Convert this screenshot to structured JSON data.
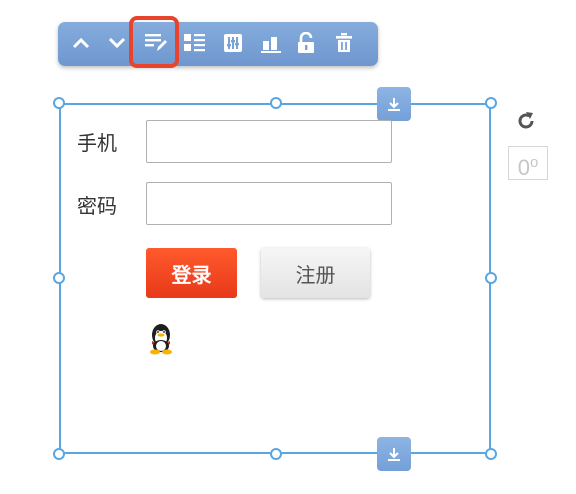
{
  "toolbar": {
    "buttons": [
      {
        "icon": "chevron-up-icon"
      },
      {
        "icon": "chevron-down-icon"
      },
      {
        "icon": "edit-icon",
        "highlighted": true
      },
      {
        "icon": "list-layout-icon"
      },
      {
        "icon": "adjust-icon"
      },
      {
        "icon": "chart-icon"
      },
      {
        "icon": "unlock-icon"
      },
      {
        "icon": "trash-icon"
      }
    ],
    "highlight_color": "#e8432c"
  },
  "rotation": {
    "angle": "0",
    "unit": "o"
  },
  "form": {
    "phone_label": "手机",
    "phone_value": "",
    "password_label": "密码",
    "password_value": "",
    "login_label": "登录",
    "register_label": "注册",
    "social_icon": "qq-penguin-icon"
  },
  "colors": {
    "selection": "#59a6e2",
    "toolbar": "#7aa2d6",
    "login_button": "#f0461f",
    "register_button": "#ececec"
  }
}
